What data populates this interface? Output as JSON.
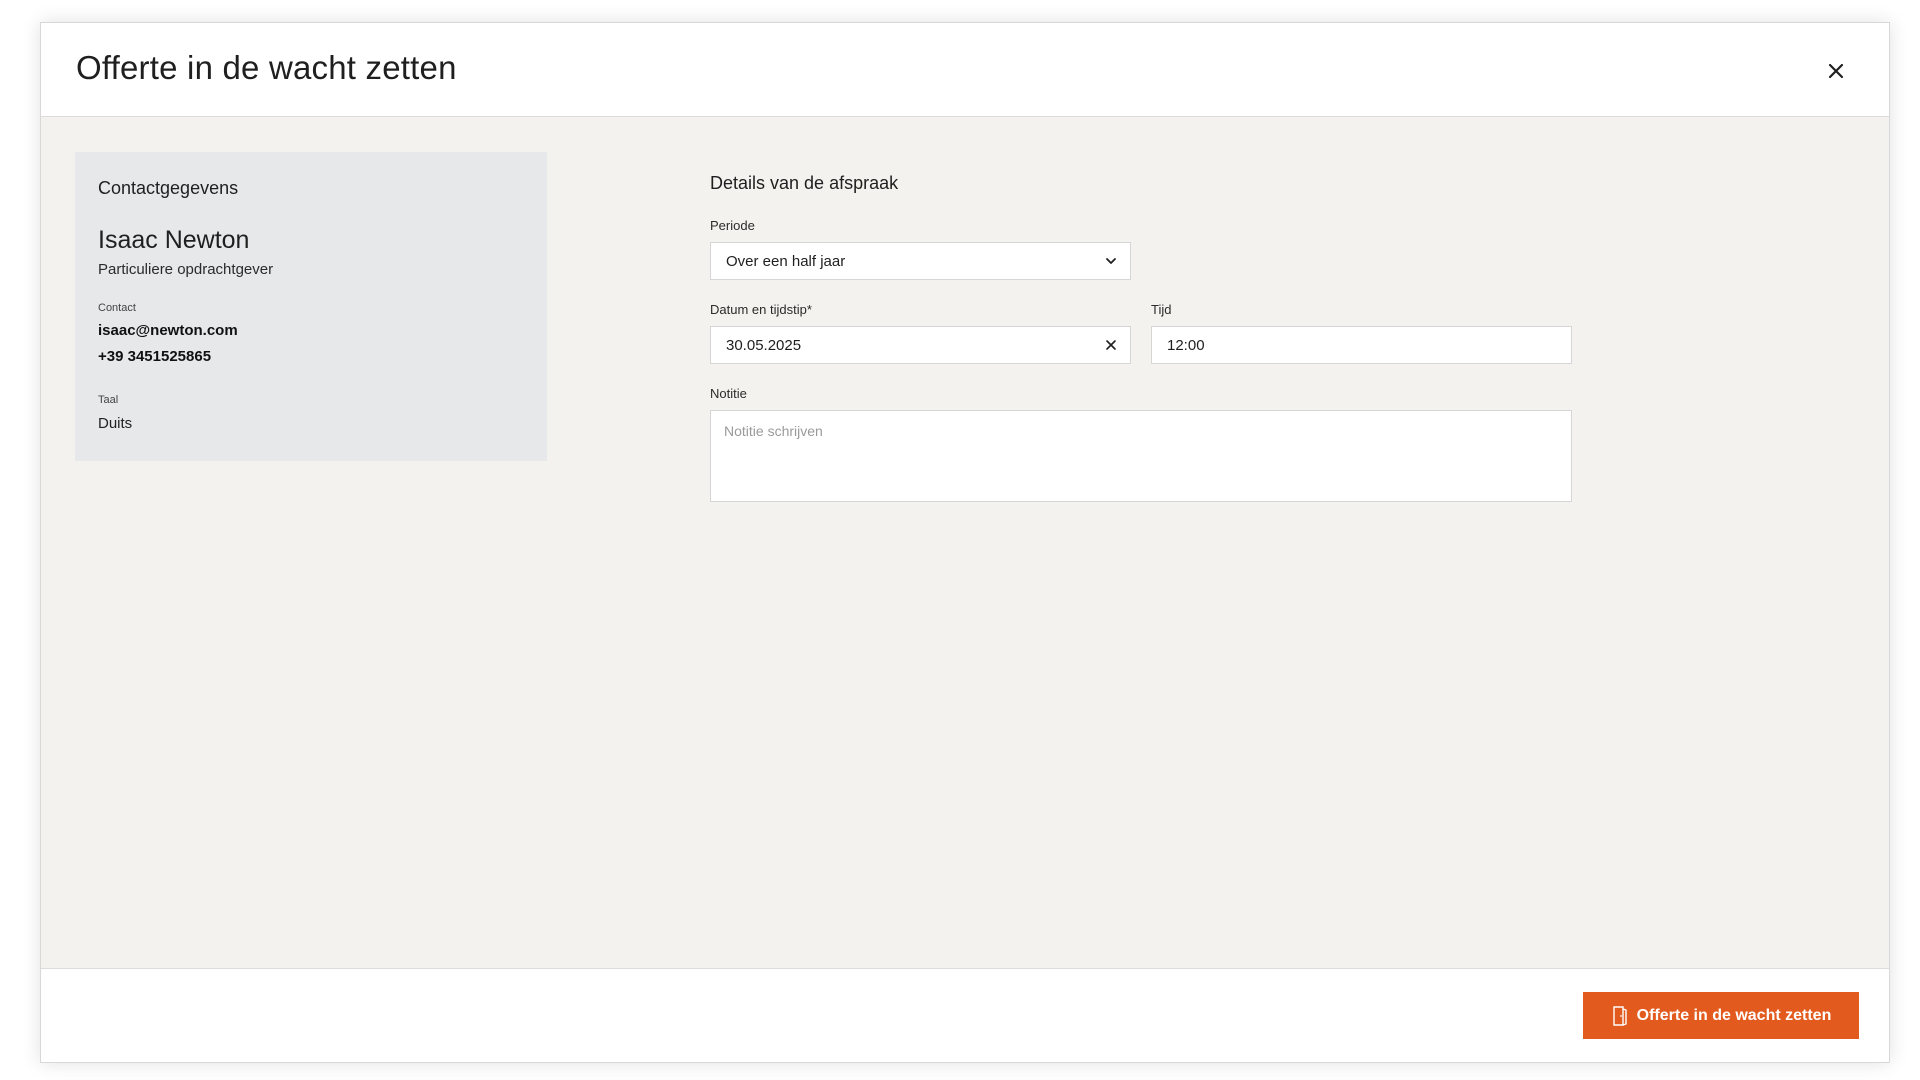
{
  "modal": {
    "title": "Offerte in de wacht zetten",
    "close_icon": "close-icon"
  },
  "contact": {
    "heading": "Contactgegevens",
    "name": "Isaac Newton",
    "role": "Particuliere opdrachtgever",
    "contact_label": "Contact",
    "email": "isaac@newton.com",
    "phone": "+39 3451525865",
    "language_label": "Taal",
    "language": "Duits"
  },
  "appointment": {
    "heading": "Details van de afspraak",
    "period": {
      "label": "Periode",
      "value": "Over een half jaar",
      "icon": "chevron-down-icon"
    },
    "date": {
      "label": "Datum en tijdstip*",
      "value": "30.05.2025",
      "icon": "clear-icon"
    },
    "time": {
      "label": "Tijd",
      "value": "12:00"
    },
    "note": {
      "label": "Notitie",
      "placeholder": "Notitie schrijven"
    }
  },
  "footer": {
    "submit_label": "Offerte in de wacht zetten",
    "submit_icon": "door-icon",
    "accent_color": "#e35a1e"
  }
}
